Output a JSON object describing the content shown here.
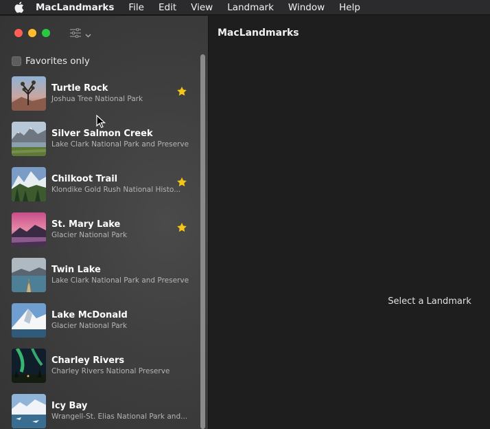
{
  "menubar": {
    "items": [
      "MacLandmarks",
      "File",
      "Edit",
      "View",
      "Landmark",
      "Window",
      "Help"
    ]
  },
  "sidebar": {
    "favorites_label": "Favorites only",
    "favorites_checked": false,
    "landmarks": [
      {
        "name": "Turtle Rock",
        "park": "Joshua Tree National Park",
        "favorite": true
      },
      {
        "name": "Silver Salmon Creek",
        "park": "Lake Clark National Park and Preserve",
        "favorite": false
      },
      {
        "name": "Chilkoot Trail",
        "park": "Klondike Gold Rush National Histo...",
        "favorite": true
      },
      {
        "name": "St. Mary Lake",
        "park": "Glacier National Park",
        "favorite": true
      },
      {
        "name": "Twin Lake",
        "park": "Lake Clark National Park and Preserve",
        "favorite": false
      },
      {
        "name": "Lake McDonald",
        "park": "Glacier National Park",
        "favorite": false
      },
      {
        "name": "Charley Rivers",
        "park": "Charley Rivers National Preserve",
        "favorite": false
      },
      {
        "name": "Icy Bay",
        "park": "Wrangell-St. Elias National Park and...",
        "favorite": false
      }
    ]
  },
  "main": {
    "title": "MacLandmarks",
    "placeholder": "Select a Landmark"
  },
  "colors": {
    "star": "#f5c518",
    "close": "#ff5f57",
    "minimize": "#febc2e",
    "zoom": "#28c840"
  }
}
